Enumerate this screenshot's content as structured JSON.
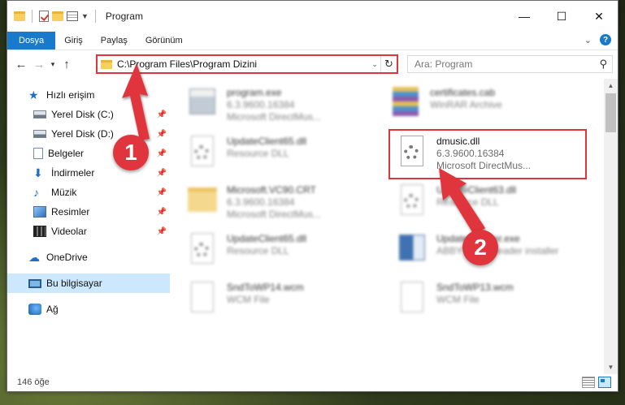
{
  "window": {
    "title": "Program",
    "controls": {
      "minimize": "—",
      "maximize": "☐",
      "close": "✕"
    }
  },
  "ribbon": {
    "tabs": [
      "Dosya",
      "Giriş",
      "Paylaş",
      "Görünüm"
    ]
  },
  "navigation": {
    "address": "C:\\Program Files\\Program Dizini",
    "search_placeholder": "Ara: Program"
  },
  "sidebar": {
    "items": [
      {
        "label": "Hızlı erişim",
        "icon": "star-icon"
      },
      {
        "label": "Yerel Disk (C:)",
        "icon": "drive-icon",
        "pinned": true
      },
      {
        "label": "Yerel Disk (D:)",
        "icon": "drive-icon",
        "pinned": true
      },
      {
        "label": "Belgeler",
        "icon": "documents-icon",
        "pinned": true
      },
      {
        "label": "İndirmeler",
        "icon": "download-icon",
        "pinned": true
      },
      {
        "label": "Müzik",
        "icon": "music-icon",
        "pinned": true
      },
      {
        "label": "Resimler",
        "icon": "pictures-icon",
        "pinned": true
      },
      {
        "label": "Videolar",
        "icon": "videos-icon",
        "pinned": true
      },
      {
        "label": "OneDrive",
        "icon": "cloud-icon"
      },
      {
        "label": "Bu bilgisayar",
        "icon": "computer-icon",
        "selected": true
      },
      {
        "label": "Ağ",
        "icon": "network-icon"
      }
    ]
  },
  "files": [
    {
      "name": "program.exe",
      "sub1": "6.3.9600.16384",
      "sub2": "Microsoft DirectMus...",
      "icon": "exe-icon"
    },
    {
      "name": "certificates.cab",
      "sub1": "WinRAR Archive",
      "sub2": "",
      "icon": "archive-icon"
    },
    {
      "name": "UpdateClient65.dll",
      "sub1": "Resource DLL",
      "sub2": "",
      "icon": "dll-icon"
    },
    {
      "name": "dmusic.dll",
      "sub1": "6.3.9600.16384",
      "sub2": "Microsoft DirectMus...",
      "icon": "dll-icon"
    },
    {
      "name": "Microsoft.VC90.CRT",
      "sub1": "6.3.9600.16384",
      "sub2": "Microsoft DirectMus...",
      "icon": "folder-icon"
    },
    {
      "name": "UpdateClient63.dll",
      "sub1": "Resource DLL",
      "sub2": "",
      "icon": "dll-icon"
    },
    {
      "name": "UpdateClient65.dll",
      "sub1": "Resource DLL",
      "sub2": "",
      "icon": "dll-icon"
    },
    {
      "name": "UpdateInstaller.exe",
      "sub1": "ABBYY FineReader installer",
      "sub2": "",
      "icon": "installer-icon"
    },
    {
      "name": "SndToWP14.wcm",
      "sub1": "WCM File",
      "sub2": "",
      "icon": "file-icon"
    },
    {
      "name": "SndToWP13.wcm",
      "sub1": "WCM File",
      "sub2": "",
      "icon": "file-icon"
    }
  ],
  "status": {
    "item_count": "146 öğe"
  },
  "annotations": {
    "step1": "1",
    "step2": "2"
  },
  "colors": {
    "accent": "#1979ca",
    "highlight": "#e0353d",
    "selection": "#cce8ff"
  }
}
